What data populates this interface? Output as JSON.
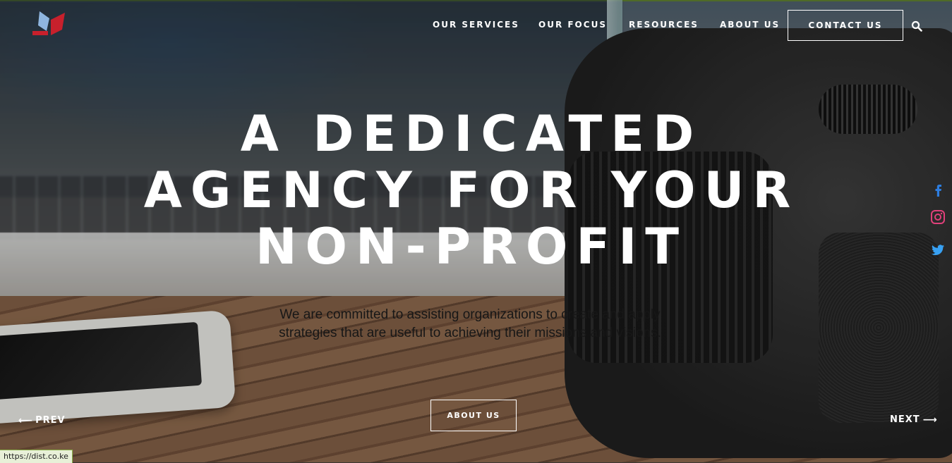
{
  "nav": {
    "items": [
      "OUR SERVICES",
      "OUR FOCUS",
      "RESOURCES",
      "ABOUT US"
    ],
    "contact_label": "CONTACT US"
  },
  "hero": {
    "headline_lines": [
      "A DEDICATED",
      "AGENCY FOR YOUR",
      "NON-PROFIT"
    ],
    "subtext": "We are committed to assisting organizations to create and apply strategies that are useful to achieving their missions and visions.",
    "button_label": "ABOUT US"
  },
  "slider": {
    "prev_label": "PREV",
    "next_label": "NEXT"
  },
  "social": {
    "icons": [
      "facebook-icon",
      "instagram-icon",
      "twitter-icon"
    ]
  },
  "status": {
    "url": "https://dist.co.ke"
  },
  "colors": {
    "facebook": "#2d7ddf",
    "instagram": "#e0407a",
    "twitter": "#38a1f3",
    "logo_red": "#c8202c",
    "logo_blue": "#8fb6e0"
  }
}
